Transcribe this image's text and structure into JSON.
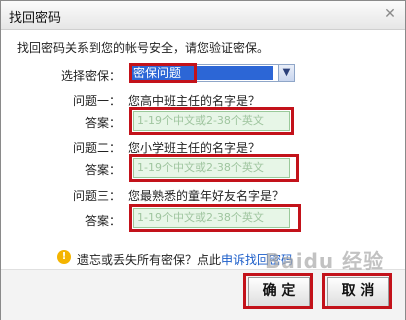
{
  "title": "找回密码",
  "intro": "找回密码关系到您的帐号安全，请您验证密保。",
  "security": {
    "label": "选择密保：",
    "selected": "密保问题"
  },
  "questions": [
    {
      "label": "问题一：",
      "text": "您高中班主任的名字是？",
      "answer_label": "答案：",
      "placeholder": "1-19个中文或2-38个英文"
    },
    {
      "label": "问题二：",
      "text": "您小学班主任的名字是？",
      "answer_label": "答案：",
      "placeholder": "1-19个中文或2-38个英文"
    },
    {
      "label": "问题三：",
      "text": "您最熟悉的童年好友名字是？",
      "answer_label": "答案：",
      "placeholder": "1-19个中文或2-38个英文"
    }
  ],
  "tip": {
    "text": "遗忘或丢失所有密保？点此",
    "link": "申诉找回密码"
  },
  "buttons": {
    "ok": "确 定",
    "cancel": "取 消"
  },
  "watermark": "Baidu 经验",
  "colors": {
    "highlight": "#c3121a",
    "select_bg": "#2c66d6",
    "input_bg": "#e7f6e7"
  },
  "icons": {
    "close": "close-icon",
    "tip": "warning-icon",
    "dropdown": "chevron-down-icon"
  }
}
